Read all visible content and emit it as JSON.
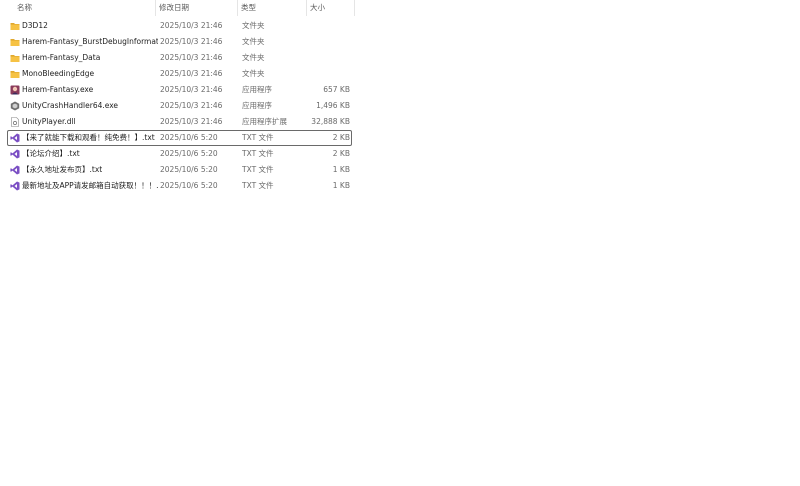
{
  "columns": {
    "name": "名称",
    "date": "修改日期",
    "type": "类型",
    "size": "大小"
  },
  "sort_indicator": "^",
  "files": [
    {
      "name": "D3D12",
      "date": "2025/10/3 21:46",
      "type": "文件夹",
      "size": "",
      "icon": "folder-icon"
    },
    {
      "name": "Harem-Fantasy_BurstDebugInformati...",
      "date": "2025/10/3 21:46",
      "type": "文件夹",
      "size": "",
      "icon": "folder-icon"
    },
    {
      "name": "Harem-Fantasy_Data",
      "date": "2025/10/3 21:46",
      "type": "文件夹",
      "size": "",
      "icon": "folder-icon"
    },
    {
      "name": "MonoBleedingEdge",
      "date": "2025/10/3 21:46",
      "type": "文件夹",
      "size": "",
      "icon": "folder-icon"
    },
    {
      "name": "Harem-Fantasy.exe",
      "date": "2025/10/3 21:46",
      "type": "应用程序",
      "size": "657 KB",
      "icon": "game-exe-icon"
    },
    {
      "name": "UnityCrashHandler64.exe",
      "date": "2025/10/3 21:46",
      "type": "应用程序",
      "size": "1,496 KB",
      "icon": "unity-exe-icon"
    },
    {
      "name": "UnityPlayer.dll",
      "date": "2025/10/3 21:46",
      "type": "应用程序扩展",
      "size": "32,888 KB",
      "icon": "dll-icon"
    },
    {
      "name": "【来了就能下载和观看！纯免费！】.txt",
      "date": "2025/10/6 5:20",
      "type": "TXT 文件",
      "size": "2 KB",
      "icon": "txt-vs-icon"
    },
    {
      "name": "【论坛介绍】.txt",
      "date": "2025/10/6 5:20",
      "type": "TXT 文件",
      "size": "2 KB",
      "icon": "txt-vs-icon"
    },
    {
      "name": "【永久地址发布页】.txt",
      "date": "2025/10/6 5:20",
      "type": "TXT 文件",
      "size": "1 KB",
      "icon": "txt-vs-icon"
    },
    {
      "name": "最新地址及APP请发邮箱自动获取！！！...",
      "date": "2025/10/6 5:20",
      "type": "TXT 文件",
      "size": "1 KB",
      "icon": "txt-vs-icon"
    }
  ],
  "selected_index": 7,
  "colors": {
    "folder": "#f6c244",
    "folder_dark": "#e0a82e",
    "vs_purple": "#7b4fc4",
    "selection_border": "#6a6a6a"
  }
}
